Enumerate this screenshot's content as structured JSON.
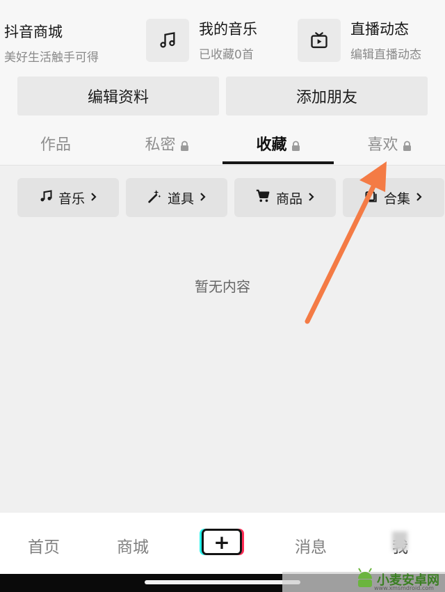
{
  "profile_services": {
    "shop": {
      "title": "抖音商城",
      "subtitle": "美好生活触手可得"
    },
    "music": {
      "title": "我的音乐",
      "subtitle": "已收藏0首",
      "icon": "music-note-icon"
    },
    "live": {
      "title": "直播动态",
      "subtitle": "编辑直播动态",
      "icon": "tv-icon"
    }
  },
  "actions": {
    "edit_profile": "编辑资料",
    "add_friends": "添加朋友"
  },
  "tabs": [
    {
      "label": "作品",
      "locked": false,
      "active": false
    },
    {
      "label": "私密",
      "locked": true,
      "active": false
    },
    {
      "label": "收藏",
      "locked": true,
      "active": true
    },
    {
      "label": "喜欢",
      "locked": true,
      "active": false
    }
  ],
  "filters": [
    {
      "label": "音乐",
      "icon": "music-note-icon"
    },
    {
      "label": "道具",
      "icon": "magic-wand-icon"
    },
    {
      "label": "商品",
      "icon": "cart-icon"
    },
    {
      "label": "合集",
      "icon": "collection-icon"
    }
  ],
  "empty_state": "暂无内容",
  "bottom_nav": {
    "home": "首页",
    "mall": "商城",
    "create": "+",
    "messages": "消息",
    "me": "我"
  },
  "annotation": {
    "arrow_color": "#f47b45"
  },
  "watermark": {
    "text": "小麦安卓网",
    "url": "www.xmsmdroid.com"
  }
}
